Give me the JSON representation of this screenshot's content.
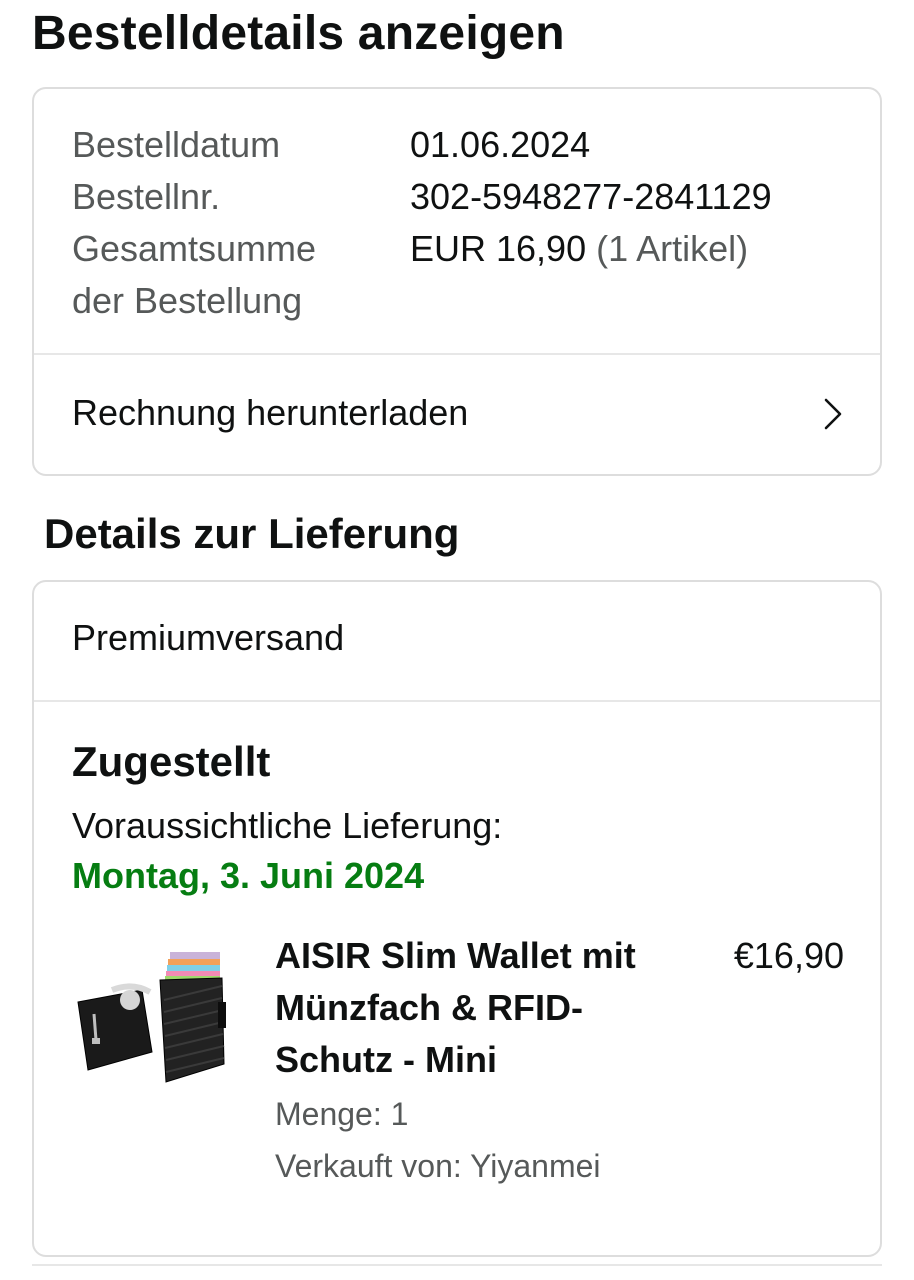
{
  "page": {
    "title": "Bestelldetails anzeigen"
  },
  "summary": {
    "order_date_label": "Bestelldatum",
    "order_date_value": "01.06.2024",
    "order_number_label": "Bestellnr.",
    "order_number_value": "302-5948277-2841129",
    "total_label": "Gesamtsumme der Bestellung",
    "total_value": "EUR 16,90",
    "total_items": "(1 Artikel)",
    "invoice_label": "Rechnung herunterladen",
    "invoice_icon": "chevron-right-icon"
  },
  "delivery": {
    "section_title": "Details zur Lieferung",
    "shipping_method": "Premiumversand",
    "status": "Zugestellt",
    "eta_label": "Voraussichtliche Lieferung:",
    "eta_date": "Montag, 3. Juni 2024",
    "eta_color": "#067d12",
    "product": {
      "image_icon": "wallet-product-image",
      "title": "AISIR Slim Wallet mit Münzfach & RFID-Schutz - Mini",
      "price": "€16,90",
      "quantity": "Menge: 1",
      "seller": "Verkauft von: Yiyanmei"
    }
  },
  "colors": {
    "text_primary": "#0f1111",
    "text_secondary": "#565959",
    "border": "#dddddd",
    "delivery_green": "#067d12"
  }
}
